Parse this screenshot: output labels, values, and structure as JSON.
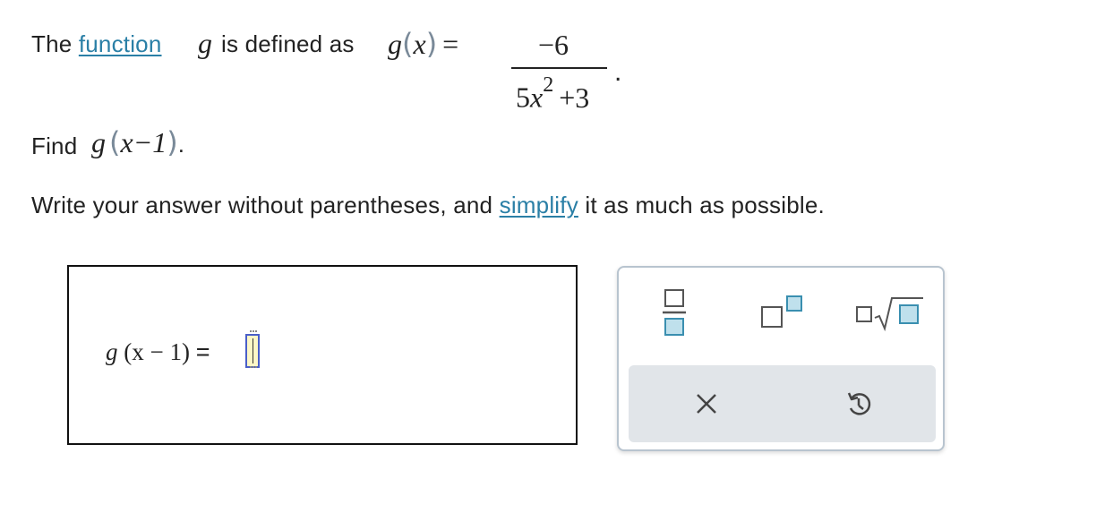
{
  "problem": {
    "line1_intro": "The",
    "function_link": "function",
    "line1_g": "g",
    "line1_mid": "is defined as",
    "gx_g": "g",
    "gx_open": "(",
    "gx_x": "x",
    "gx_close": ")",
    "equals": "=",
    "numerator": "−6",
    "den_coef": "5",
    "den_var": "x",
    "den_exp": "2",
    "den_plus": "+3",
    "period": ".",
    "find_label": "Find",
    "find_g": "g",
    "find_open": "(",
    "find_arg": "x−1",
    "find_close": ")",
    "find_period": ".",
    "instruction_before": "Write your answer without parentheses, and",
    "simplify_link": "simplify",
    "instruction_after": "it as much as possible."
  },
  "answer": {
    "lhs_g": "g",
    "lhs_arg": "(x − 1)",
    "lhs_eq": "=",
    "value": ""
  },
  "palette": {
    "buttons": [
      "fraction-template",
      "exponent-template",
      "nth-root-template"
    ],
    "actions": [
      "clear",
      "undo"
    ]
  },
  "colors": {
    "link": "#2a7fa6",
    "palette_border": "#b8c4cf",
    "action_bar": "#e1e5e9",
    "cursor_fill": "#fdf7c7",
    "cursor_border": "#4a5fc8",
    "icon_teal": "#3a8fb0"
  }
}
